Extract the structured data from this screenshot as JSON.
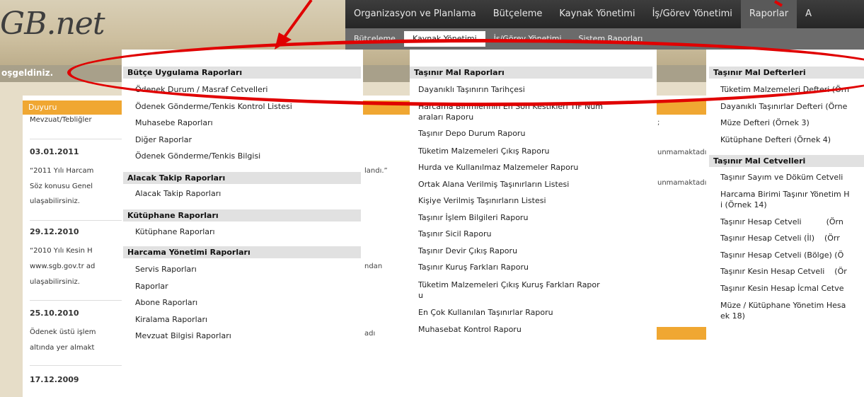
{
  "logo": "GB.net",
  "topnav": [
    "Organizasyon ve Planlama",
    "Bütçeleme",
    "Kaynak Yönetimi",
    "İş/Görev Yönetimi",
    "Raporlar",
    "A"
  ],
  "subnav": [
    "Bütçeleme",
    "Kaynak Yönetimi",
    "İş/Görev Yönetimi",
    "Sistem Raporları"
  ],
  "welcome": "oşgeldiniz.",
  "duyuru": "Duyuru",
  "news": {
    "n1": "Mevzuat/Tebliğler",
    "d1": "03.01.2011",
    "t1a": "“2011 Yılı Harcam",
    "t1b": "Söz konusu Genel",
    "t1c": "ulaşabilirsiniz.",
    "d2": "29.12.2010",
    "t2a": "“2010 Yılı Kesin H",
    "t2b": "www.sgb.gov.tr ad",
    "t2c": "ulaşabilirsiniz.",
    "d3": "25.10.2010",
    "t3a": "Ödenek üstü işlem",
    "t3b": "altında yer almakt",
    "d4": "17.12.2009"
  },
  "fragments": {
    "f1": "landı.”",
    "f2": "ndan",
    "f3": "adı",
    "f4": "unmamaktadı",
    "f5": "unmamaktadı",
    "f6": ";"
  },
  "menu": {
    "col1": {
      "s1": "Bütçe Uygulama Raporları",
      "s1_items": [
        "Ödenek Durum / Masraf Cetvelleri",
        "Ödenek Gönderme/Tenkis Kontrol Listesi",
        "Muhasebe Raporları",
        "Diğer Raporlar",
        "Ödenek Gönderme/Tenkis Bilgisi"
      ],
      "s2": "Alacak Takip Raporları",
      "s2_items": [
        "Alacak Takip Raporları"
      ],
      "s3": "Kütüphane Raporları",
      "s3_items": [
        "Kütüphane Raporları"
      ],
      "s4": "Harcama Yönetimi Raporları",
      "s4_items": [
        "Servis Raporları",
        "Raporlar",
        "Abone Raporları",
        "Kiralama Raporları",
        "Mevzuat Bilgisi Raporları"
      ]
    },
    "col2": {
      "s1": "Taşınır Mal Raporları",
      "items": [
        "Dayanıklı Taşınırın Tarihçesi",
        "Harcama Birimlerinin En Son Kestikleri TİF Num",
        "araları Raporu",
        "Taşınır Depo Durum Raporu",
        "Tüketim Malzemeleri Çıkış Raporu",
        "Hurda ve Kullanılmaz Malzemeler Raporu",
        "Ortak Alana Verilmiş Taşınırların Listesi",
        "Kişiye Verilmiş Taşınırların Listesi",
        "Taşınır İşlem Bilgileri Raporu",
        "Taşınır Sicil Raporu",
        "Taşınır Devir Çıkış Raporu",
        "Taşınır Kuruş Farkları Raporu",
        "Tüketim Malzemeleri Çıkış Kuruş Farkları Rapor",
        "u",
        "En Çok Kullanılan Taşınırlar Raporu",
        "Muhasebat Kontrol Raporu"
      ]
    },
    "col3": {
      "s1": "Taşınır Mal Defterleri",
      "s1_items": [
        "Tüketim Malzemeleri Defteri (Örn",
        "Dayanıklı Taşınırlar Defteri (Örne",
        "Müze Defteri (Örnek 3)",
        "Kütüphane Defteri (Örnek 4)"
      ],
      "s2": "Taşınır Mal Cetvelleri",
      "s2_items": [
        "Taşınır Sayım ve Döküm Cetveli",
        "Harcama Birimi Taşınır Yönetim H",
        "i (Örnek 14)",
        "Taşınır Hesap Cetveli          (Örn",
        "Taşınır Hesap Cetveli (İl)    (Örr",
        "Taşınır Hesap Cetveli (Bölge) (Ö",
        "Taşınır Kesin Hesap Cetveli    (Ör",
        "Taşınır Kesin Hesap İcmal Cetve",
        "Müze / Kütüphane Yönetim Hesa",
        "ek 18)"
      ]
    }
  },
  "colors": {
    "annotation": "#e00000",
    "accent": "#f0a732",
    "nav": "#2f2f2f"
  }
}
